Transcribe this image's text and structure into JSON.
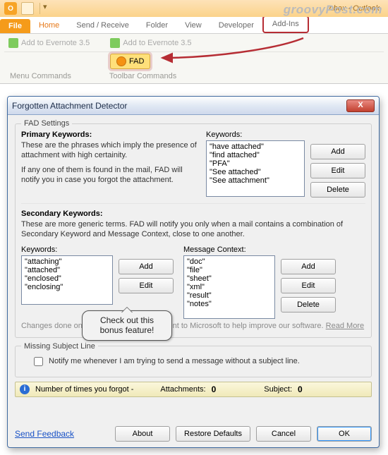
{
  "app": {
    "window_title": "Inbox - Outlook",
    "watermark": "groovyPost.com"
  },
  "ribbon": {
    "tabs": [
      "File",
      "Home",
      "Send / Receive",
      "Folder",
      "View",
      "Developer",
      "Add-Ins"
    ],
    "evernote1": "Add to Evernote 3.5",
    "evernote2": "Add to Evernote 3.5",
    "fad_label": "FAD",
    "group1": "Menu Commands",
    "group2": "Toolbar Commands"
  },
  "dialog": {
    "title": "Forgotten Attachment Detector",
    "settings_legend": "FAD Settings",
    "primary_heading": "Primary Keywords:",
    "primary_desc1": "These are the phrases which imply the presence of attachment with high certainity.",
    "primary_desc2": "If any one of them is found in the mail, FAD will notify you in case you forgot the attachment.",
    "keywords_label": "Keywords:",
    "primary_keywords": [
      "\"have attached\"",
      "\"find attached\"",
      "\"PFA\"",
      "\"See attached\"",
      "\"See attachment\""
    ],
    "secondary_heading": "Secondary Keywords:",
    "secondary_desc": "These are more generic terms. FAD will notify you only when a mail contains a combination of Secondary Keyword and Message Context, close to one another.",
    "secondary_keywords": [
      "\"attaching\"",
      "\"attached\"",
      "\"enclosed\"",
      "\"enclosing\""
    ],
    "context_label": "Message Context:",
    "context_items": [
      "\"doc\"",
      "\"file\"",
      "\"sheet\"",
      "\"xml\"",
      "\"result\"",
      "\"notes\""
    ],
    "btn_add": "Add",
    "btn_edit": "Edit",
    "btn_delete": "Delete",
    "hint": "Changes done on these keywords will be sent to Microsoft to help improve our software.",
    "hint_link": "Read More",
    "missing_legend": "Missing Subject Line",
    "missing_text": "Notify me whenever I am trying to send a message without a subject line.",
    "status_prefix": "Number of times you forgot -",
    "status_att": "Attachments:",
    "status_att_val": "0",
    "status_sub": "Subject:",
    "status_sub_val": "0",
    "feedback": "Send Feedback",
    "btn_about": "About",
    "btn_restore": "Restore Defaults",
    "btn_cancel": "Cancel",
    "btn_ok": "OK"
  },
  "callout": "Check out this bonus feature!"
}
